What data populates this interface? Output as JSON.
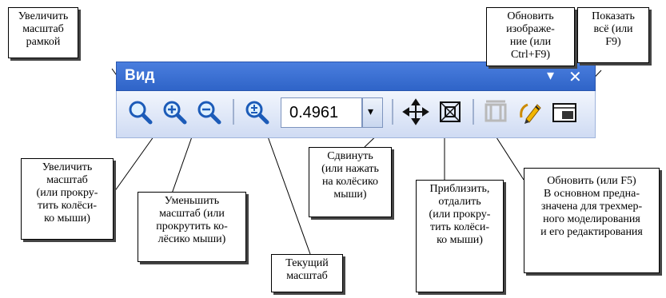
{
  "toolbar": {
    "title": "Вид",
    "menu_glyph": "▾",
    "close_glyph": "✕",
    "scale_value": "0.4961",
    "dropdown_glyph": "▾",
    "buttons": [
      "zoom-frame",
      "zoom-in",
      "zoom-out",
      "current-scale",
      "pan",
      "zoom-fit",
      "refresh",
      "redraw",
      "show-all"
    ]
  },
  "callouts": {
    "zoom_frame": "Увеличить\nмасштаб\nрамкой",
    "redraw": "Обновить изображе-\nние (или Ctrl+F9)",
    "show_all": "Показать\nвсё (или\nF9)",
    "zoom_in": "Увеличить\nмасштаб\n(или прокру-\nтить колёси-\nко мыши)",
    "zoom_out": "Уменьшить\nмасштаб (или\nпрокрутить ко-\nлёсико мыши)",
    "current_scale": "Текущий\nмасштаб",
    "pan": "Сдвинуть\n(или нажать\nна колёсико\nмыши)",
    "zoom_fit": "Приблизить,\nотдалить\n(или прокру-\nтить колёси-\nко мыши)",
    "refresh": "Обновить (или F5)\nВ основном предна-\nзначена для трехмер-\nного моделирования\nи его редактирования"
  }
}
